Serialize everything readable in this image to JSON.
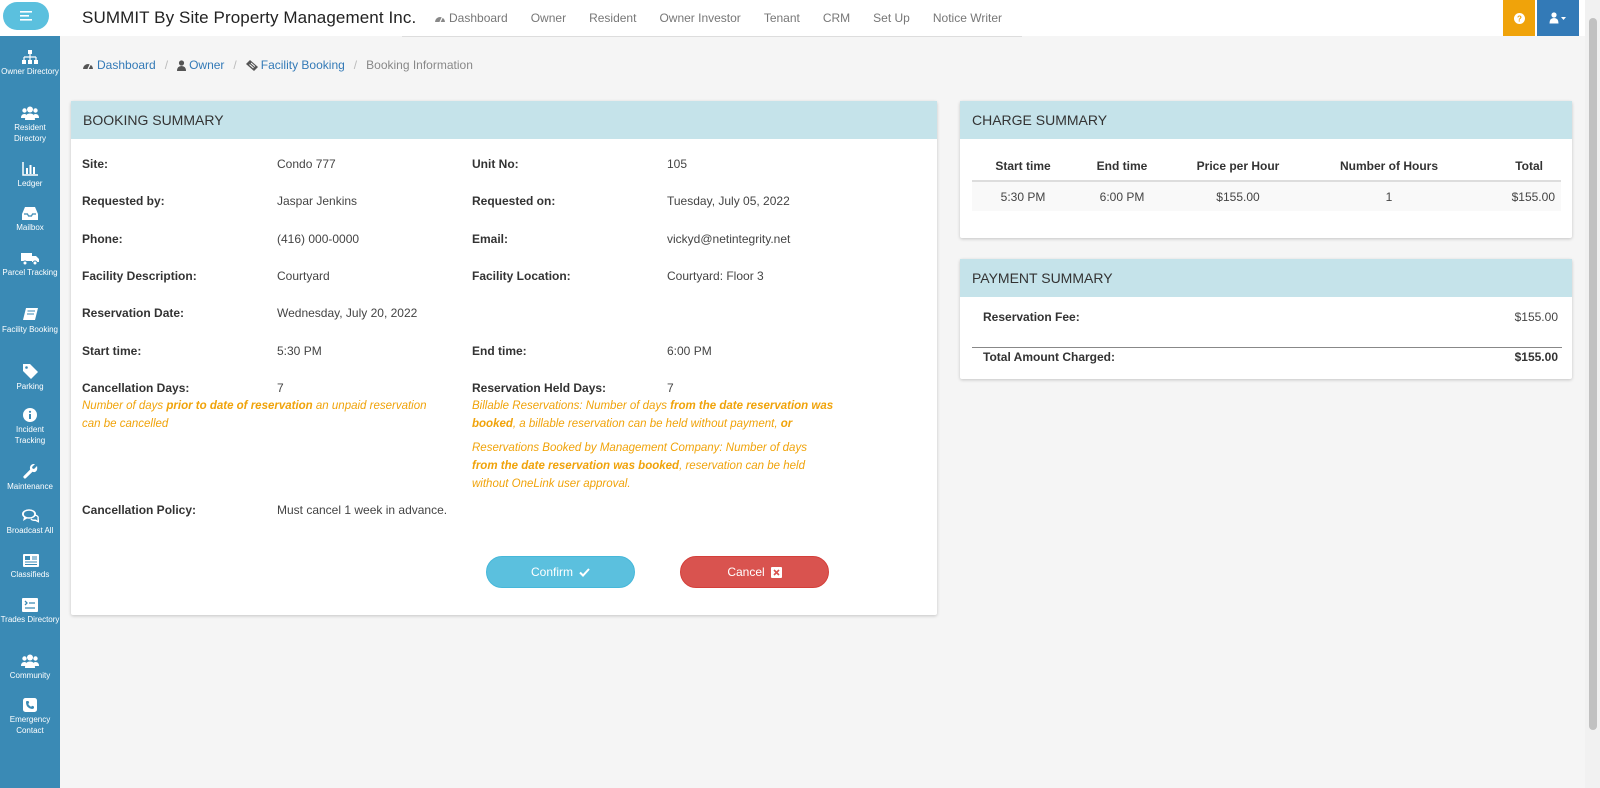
{
  "app": {
    "brand": "SUMMIT By Site Property Management Inc."
  },
  "topnav": [
    {
      "label": "Dashboard",
      "icon": "dashboard-icon"
    },
    {
      "label": "Owner"
    },
    {
      "label": "Resident"
    },
    {
      "label": "Owner Investor"
    },
    {
      "label": "Tenant"
    },
    {
      "label": "CRM"
    },
    {
      "label": "Set Up"
    },
    {
      "label": "Notice Writer"
    }
  ],
  "sidebar": [
    {
      "label": "Owner Directory",
      "icon": "sitemap-icon"
    },
    {
      "label": "Resident Directory",
      "icon": "users-icon"
    },
    {
      "label": "Ledger",
      "icon": "bar-chart-icon"
    },
    {
      "label": "Mailbox",
      "icon": "inbox-icon"
    },
    {
      "label": "Parcel Tracking",
      "icon": "truck-icon"
    },
    {
      "label": "Facility Booking",
      "icon": "book-icon"
    },
    {
      "label": "Parking",
      "icon": "tag-icon"
    },
    {
      "label": "Incident Tracking",
      "icon": "info-icon"
    },
    {
      "label": "Maintenance",
      "icon": "wrench-icon"
    },
    {
      "label": "Broadcast All",
      "icon": "comments-icon"
    },
    {
      "label": "Classifieds",
      "icon": "newspaper-icon"
    },
    {
      "label": "Trades Directory",
      "icon": "list-icon"
    },
    {
      "label": "Community",
      "icon": "community-icon"
    },
    {
      "label": "Emergency Contact",
      "icon": "phone-icon"
    }
  ],
  "breadcrumb": {
    "dashboard": "Dashboard",
    "owner": "Owner",
    "facility": "Facility Booking",
    "current": "Booking Information"
  },
  "booking": {
    "title": "BOOKING SUMMARY",
    "site_label": "Site:",
    "site": "Condo 777",
    "unit_label": "Unit No:",
    "unit": "105",
    "requested_by_label": "Requested by:",
    "requested_by": "Jaspar Jenkins",
    "requested_on_label": "Requested on:",
    "requested_on": "Tuesday, July 05, 2022",
    "phone_label": "Phone:",
    "phone": "(416) 000-0000",
    "email_label": "Email:",
    "email": "vickyd@netintegrity.net",
    "facility_desc_label": "Facility Description:",
    "facility_desc": "Courtyard",
    "facility_loc_label": "Facility Location:",
    "facility_loc": "Courtyard: Floor 3",
    "res_date_label": "Reservation Date:",
    "res_date": "Wednesday, July 20, 2022",
    "start_label": "Start time:",
    "start": "5:30 PM",
    "end_label": "End time:",
    "end": "6:00 PM",
    "cancel_days_label": "Cancellation Days:",
    "cancel_days": "7",
    "held_days_label": "Reservation Held Days:",
    "held_days": "7",
    "cancel_note": {
      "a": "Number of days ",
      "b": "prior to date of reservation",
      "c": " an unpaid reservation can be cancelled"
    },
    "billable_note": {
      "a": "Billable Reservations: Number of days ",
      "b": "from the date reservation was booked",
      "c": ", a billable reservation can be held without payment, ",
      "d": "or"
    },
    "mgmt_note": {
      "a": "Reservations Booked by Management Company: Number of days ",
      "b": "from the date reservation was booked",
      "c": ", reservation can be held without OneLink user approval."
    },
    "policy_label": "Cancellation Policy:",
    "policy": "Must cancel 1 week in advance.",
    "confirm": "Confirm",
    "cancel": "Cancel"
  },
  "charge": {
    "title": "CHARGE SUMMARY",
    "headers": [
      "Start time",
      "End time",
      "Price per Hour",
      "Number of Hours",
      "Total"
    ],
    "rows": [
      [
        "5:30 PM",
        "6:00 PM",
        "$155.00",
        "1",
        "$155.00"
      ]
    ]
  },
  "payment": {
    "title": "PAYMENT SUMMARY",
    "fee_label": "Reservation Fee:",
    "fee": "$155.00",
    "total_label": "Total Amount Charged:",
    "total": "$155.00"
  },
  "colors": {
    "accent": "#5bc0de",
    "sidebar": "#3a8ab5",
    "panel_header": "#c5e3ea",
    "note": "#f0a30a",
    "danger": "#d9534f",
    "link": "#337ab7"
  }
}
